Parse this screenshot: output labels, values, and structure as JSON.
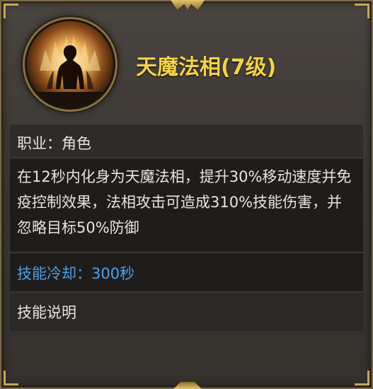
{
  "skill": {
    "name": "天魔法相(7级)",
    "icon": "demon-avatar-icon"
  },
  "details": {
    "profession": "职业：角色",
    "description": "在12秒内化身为天魔法相，提升30%移动速度并免疫控制效果，法相攻击可造成310%技能伤害，并忽略目标50%防御",
    "cooldown": "技能冷却：300秒",
    "skill_description_label": "技能说明"
  },
  "colors": {
    "title": "#f3d24a",
    "cooldown": "#4aa0e8",
    "body_text": "#e8e4dc",
    "frame_gold": "#c8a45a"
  }
}
